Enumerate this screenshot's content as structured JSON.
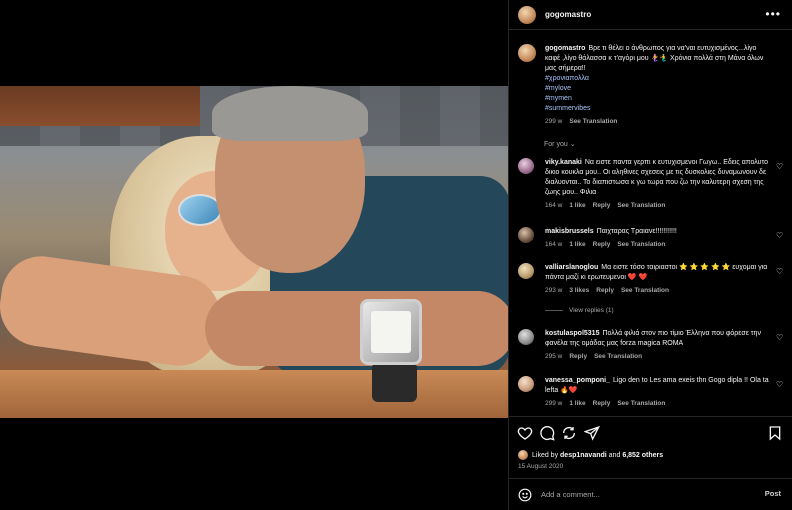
{
  "header": {
    "username": "gogomastro",
    "more_icon": "more-horizontal-icon"
  },
  "caption": {
    "username": "gogomastro",
    "text": "Βρε τι θέλει ο άνθρωπος για να'ναι ευτυχισμένος...λίγο καφέ ,λίγο θάλασσα κ τ'αγόρι μου 🧜‍♀️🧜‍♂️ Χρόνια πολλά στη Μάνα όλων μας σήμερα!!",
    "tags": [
      "#χρονιαπολλα",
      "#mylove",
      "#mymen",
      "#summervibes"
    ],
    "time": "299 w",
    "translate": "See Translation"
  },
  "for_you": "For you",
  "comments": [
    {
      "username": "viky.kanaki",
      "text": "Να ειστε παντα γερπι κ ευτυχισμενοι Γωγω.. Εδεις απολυτο δικιο κουκλα μου.. Οι αληθινες σχεσεις με τις δυσκολιες δυναμωνουν δε διαλυονται.. Το διαπιστωσα κ γω τωρα που ζω την καλυτερη σχεση της ζωης μου.. Φιλια",
      "time": "164 w",
      "likes": "1 like",
      "reply": "Reply",
      "translate": "See Translation"
    },
    {
      "username": "makisbrussels",
      "text": "Παιχταρας Τραιανε!!!!!!!!!!!",
      "time": "164 w",
      "likes": "1 like",
      "reply": "Reply",
      "translate": "See Translation"
    },
    {
      "username": "valliarslanoglou",
      "text": "Μα ειστε τόσο ταιριαστοι ⭐ ⭐ ⭐ ⭐ ⭐ ευχομαι για πάντα μαζί κι ερωτευμενοι ❤️ ❤️",
      "time": "293 w",
      "likes": "3 likes",
      "reply": "Reply",
      "translate": "See Translation"
    },
    {
      "username": "kostulaspol5315",
      "text": "Πολλά φιλιά στον πιο τίμιο Έλληνα που φόρεσε την φανέλα της ομάδας μας forza magica ROMA",
      "time": "295 w",
      "likes": "",
      "reply": "Reply",
      "translate": "See Translation"
    },
    {
      "username": "vanessa_pomponi_",
      "text": "Ligo den to Les ama exeis thn Gogo dipla !! Ola ta lefta 🔥❤️",
      "time": "299 w",
      "likes": "1 like",
      "reply": "Reply",
      "translate": "See Translation"
    }
  ],
  "view_replies": "View replies (1)",
  "actions": {
    "icons": [
      "heart-icon",
      "comment-icon",
      "share-icon",
      "send-icon",
      "bookmark-icon"
    ],
    "liked_by_prefix": "Liked by",
    "liked_by_user": "desp1navandi",
    "liked_by_and": "and",
    "liked_by_others": "6,852 others",
    "date": "15 August 2020"
  },
  "add_comment": {
    "placeholder": "Add a comment...",
    "post": "Post"
  }
}
